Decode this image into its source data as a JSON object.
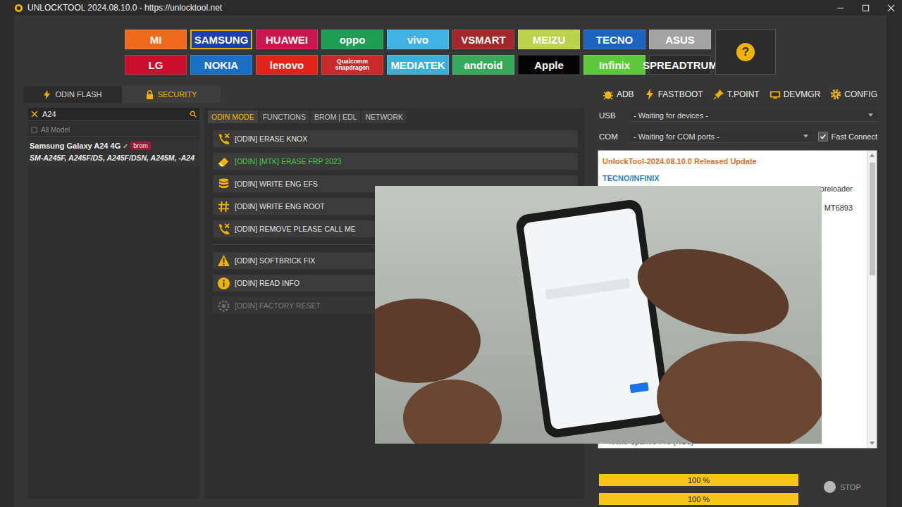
{
  "window": {
    "title": "UNLOCKTOOL 2024.08.10.0 - https://unlocktool.net"
  },
  "brands": [
    {
      "label": "MI",
      "color": "#f26a1b",
      "selected": false
    },
    {
      "label": "SAMSUNG",
      "color": "#1a3fb0",
      "selected": true
    },
    {
      "label": "HUAWEI",
      "color": "#c7174e",
      "selected": false
    },
    {
      "label": "oppo",
      "color": "#1f9d55",
      "selected": false
    },
    {
      "label": "vivo",
      "color": "#3fb3e3",
      "selected": false
    },
    {
      "label": "VSMART",
      "color": "#a3282b",
      "selected": false
    },
    {
      "label": "MEIZU",
      "color": "#bcd24a",
      "selected": false
    },
    {
      "label": "TECNO",
      "color": "#1b64c0",
      "selected": false
    },
    {
      "label": "ASUS",
      "color": "#a3a3a3",
      "selected": false
    },
    {
      "label": "LG",
      "color": "#c8102e",
      "selected": false
    },
    {
      "label": "NOKIA",
      "color": "#1a6fc4",
      "selected": false
    },
    {
      "label": "lenovo",
      "color": "#e2231a",
      "selected": false
    },
    {
      "label": "Qualcomm snapdragon",
      "color": "#c92a2a",
      "selected": false
    },
    {
      "label": "MEDIATEK",
      "color": "#3bb0d6",
      "selected": false
    },
    {
      "label": "android",
      "color": "#3aa85a",
      "selected": false
    },
    {
      "label": "Apple",
      "color": "#050505",
      "selected": false
    },
    {
      "label": "Infinix",
      "color": "#5cc83a",
      "selected": false
    },
    {
      "label": "SPREADTRUM",
      "color": "#2a2a2a",
      "selected": false
    }
  ],
  "help": {
    "label": "?"
  },
  "mode_tabs": [
    {
      "label": "ODIN FLASH",
      "selected": false
    },
    {
      "label": "SECURITY",
      "selected": true
    }
  ],
  "search": {
    "value": "A24"
  },
  "models": {
    "all_label": "All Model",
    "items": [
      {
        "name": "Samsung Galaxy A24 4G",
        "mark": "✓",
        "badge": "brom",
        "selected": true,
        "variants": "SM-A245F, A245F/DS, A245F/DSN, A245M, -A24"
      }
    ]
  },
  "function_tabs": [
    {
      "label": "ODIN MODE",
      "selected": true
    },
    {
      "label": "FUNCTIONS",
      "selected": false
    },
    {
      "label": "BROM | EDL",
      "selected": false
    },
    {
      "label": "NETWORK",
      "selected": false
    }
  ],
  "functions": [
    {
      "kind": "action",
      "label": "[ODIN] ERASE KNOX",
      "color": "#e4e4e4",
      "disabled": false
    },
    {
      "kind": "action",
      "label": "[ODIN] [MTK] ERASE FRP 2023",
      "color": "#46c846",
      "disabled": false
    },
    {
      "kind": "action",
      "label": "[ODIN] WRITE ENG EFS",
      "color": "#e4e4e4",
      "disabled": false
    },
    {
      "kind": "action",
      "label": "[ODIN] WRITE ENG ROOT",
      "color": "#e4e4e4",
      "disabled": false
    },
    {
      "kind": "action",
      "label": "[ODIN] REMOVE PLEASE CALL ME",
      "color": "#e4e4e4",
      "disabled": false
    },
    {
      "kind": "separator"
    },
    {
      "kind": "action",
      "label": "[ODIN] SOFTBRICK FIX",
      "color": "#e4e4e4",
      "disabled": false
    },
    {
      "kind": "action",
      "label": "[ODIN] READ INFO",
      "color": "#e4e4e4",
      "disabled": false
    },
    {
      "kind": "action",
      "label": "[ODIN] FACTORY RESET",
      "color": "#7c7c7c",
      "disabled": true
    }
  ],
  "toolbar": [
    {
      "label": "ADB"
    },
    {
      "label": "FASTBOOT"
    },
    {
      "label": "T.POINT"
    },
    {
      "label": "DEVMGR"
    },
    {
      "label": "CONFIG"
    }
  ],
  "usb": {
    "label": "USB",
    "value": "- Waiting for devices -"
  },
  "com": {
    "label": "COM",
    "value": "- Waiting for COM ports -"
  },
  "fast_connect": {
    "label": "Fast Connect",
    "checked": true
  },
  "log": [
    {
      "kind": "title",
      "text": "UnlockTool-2024.08.10.0 Released Update",
      "color": "#e0702a"
    },
    {
      "kind": "heading",
      "text": "TECNO/INFINIX",
      "color": "#2f7fc1"
    },
    {
      "kind": "fragment",
      "text": "preloader",
      "color": "#333333"
    },
    {
      "kind": "fragment",
      "text": ", MT6893",
      "color": "#333333"
    },
    {
      "kind": "footer",
      "text": "- Tecno Spark 8 Pro (KG8)",
      "color": "#333333"
    }
  ],
  "progress": [
    {
      "level": 1,
      "reading": "100 %"
    },
    {
      "level": 1,
      "reading": "100 %"
    }
  ],
  "stop": {
    "label": "STOP",
    "disabled": true
  }
}
